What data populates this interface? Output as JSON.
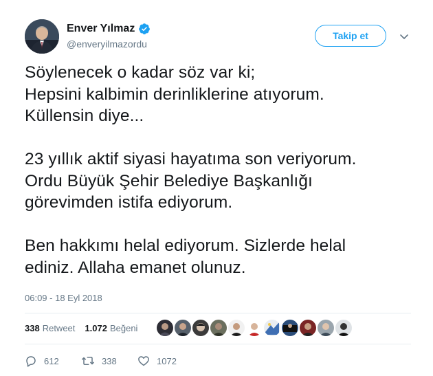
{
  "user": {
    "display_name": "Enver Yılmaz",
    "handle": "@enveryilmazordu",
    "verified": true
  },
  "follow_button": {
    "label": "Takip et"
  },
  "tweet": {
    "lines": [
      "Söylenecek o kadar söz var ki;",
      "Hepsini kalbimin derinliklerine atıyorum.",
      "Küllensin diye...",
      "",
      "23 yıllık aktif siyasi hayatıma son veriyorum.",
      "Ordu Büyük Şehir Belediye Başkanlığı",
      "görevimden istifa ediyorum.",
      "",
      "Ben hakkımı helal ediyorum. Sizlerde helal",
      "ediniz. Allaha emanet olunuz."
    ],
    "timestamp": "06:09 - 18 Eyl 2018"
  },
  "stats": {
    "retweet_count": "338",
    "retweet_label": "Retweet",
    "like_count": "1.072",
    "like_label": "Beğeni"
  },
  "actions": {
    "reply_count": "612",
    "retweet_count": "338",
    "like_count": "1072"
  },
  "colors": {
    "accent": "#1da1f2",
    "text": "#14171a",
    "muted": "#657786",
    "divider": "#e6ecf0"
  },
  "icons": {
    "verified": "verified-badge-icon",
    "caret": "chevron-down-icon",
    "reply": "reply-icon",
    "retweet": "retweet-icon",
    "like": "heart-icon"
  }
}
